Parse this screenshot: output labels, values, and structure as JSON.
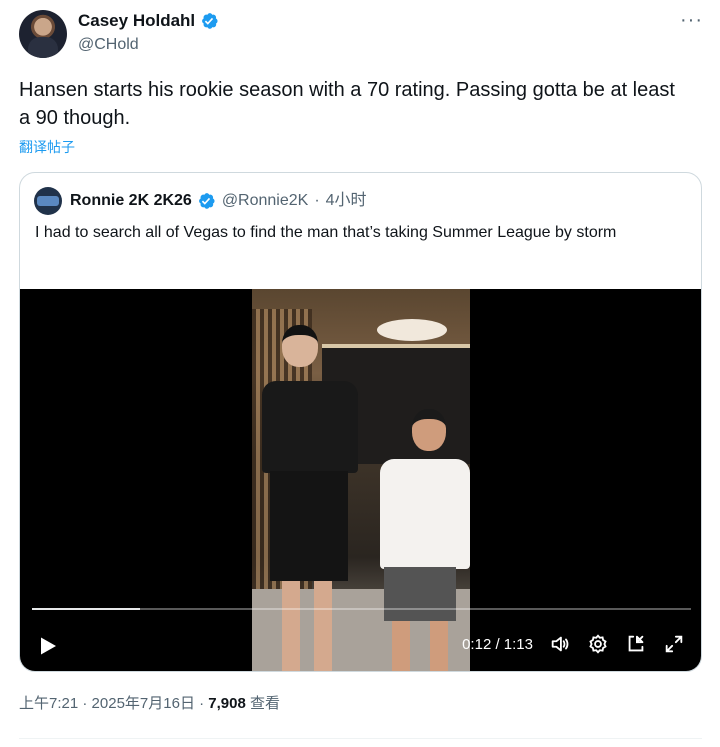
{
  "tweet": {
    "author_name": "Casey Holdahl",
    "handle": "@CHold",
    "text": "Hansen starts his rookie season with a 70 rating. Passing gotta be at least a 90 though.",
    "translate_label": "翻译帖子",
    "more_label": "···"
  },
  "quote": {
    "author_name": "Ronnie 2K 2K26",
    "handle": "@Ronnie2K",
    "separator": "·",
    "time_ago": "4小时",
    "text": "I had to search all of Vegas to find the man that’s taking Summer League by storm"
  },
  "video": {
    "current_time": "0:12",
    "total_time": "1:13",
    "time_display": "0:12 / 1:13",
    "progress_fraction": 0.164
  },
  "footer": {
    "time": "上午7:21",
    "date": "2025年7月16日",
    "views_count": "7,908",
    "views_label": "查看",
    "sep": " · "
  },
  "colors": {
    "verified_blue": "#1d9bf0",
    "muted_text": "#536471",
    "link_blue": "#1d9bf0"
  },
  "icons": {
    "verified": "verified-badge-icon",
    "play": "play-icon",
    "volume": "volume-icon",
    "settings": "gear-icon",
    "pip": "picture-in-picture-icon",
    "fullscreen": "expand-icon",
    "more": "more-icon"
  }
}
